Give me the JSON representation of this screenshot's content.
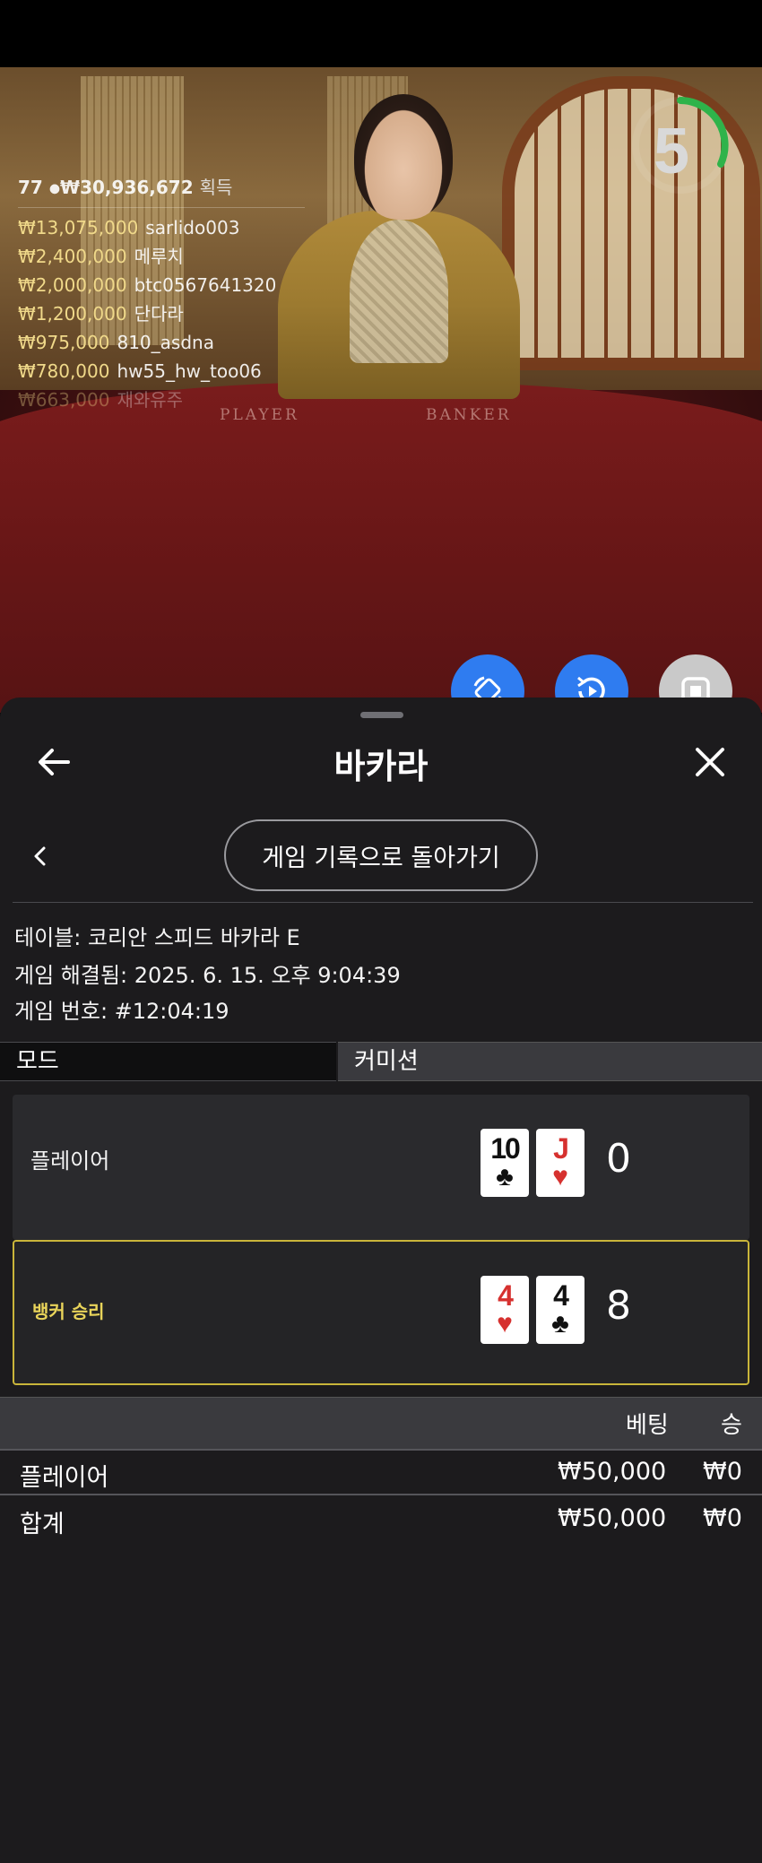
{
  "video": {
    "timer_value": "5",
    "table_labels": {
      "player": "PLAYER",
      "banker": "BANKER"
    },
    "winners": {
      "count": "77",
      "total": "₩30,936,672",
      "title": "획득",
      "rows": [
        {
          "amount": "₩13,075,000",
          "name": "sarlido003"
        },
        {
          "amount": "₩2,400,000",
          "name": "메루치"
        },
        {
          "amount": "₩2,000,000",
          "name": "btc0567641320"
        },
        {
          "amount": "₩1,200,000",
          "name": "단다라"
        },
        {
          "amount": "₩975,000",
          "name": "810_asdna"
        },
        {
          "amount": "₩780,000",
          "name": "hw55_hw_too06"
        },
        {
          "amount": "₩663,000",
          "name": "재와유주"
        }
      ]
    }
  },
  "sheet": {
    "title": "바카라",
    "back_to_history": "게임 기록으로 돌아가기",
    "info": {
      "table": "테이블: 코리안 스피드 바카라 E",
      "resolved": "게임 해결됨: 2025. 6. 15. 오후 9:04:39",
      "game_no": "게임 번호: #12:04:19"
    },
    "mode": {
      "label": "모드",
      "value": "커미션"
    },
    "hands": [
      {
        "label": "플레이어",
        "cards": [
          {
            "rank": "10",
            "suit": "♣",
            "color": "black"
          },
          {
            "rank": "J",
            "suit": "♥",
            "color": "red"
          }
        ],
        "score": "0",
        "winner": false
      },
      {
        "label": "뱅커 승리",
        "cards": [
          {
            "rank": "4",
            "suit": "♥",
            "color": "red"
          },
          {
            "rank": "4",
            "suit": "♣",
            "color": "black"
          }
        ],
        "score": "8",
        "winner": true
      }
    ],
    "bets": {
      "col_bet": "베팅",
      "col_win": "승",
      "rows": [
        {
          "label": "플레이어",
          "bet": "₩50,000",
          "win": "₩0"
        },
        {
          "label": "합계",
          "bet": "₩50,000",
          "win": "₩0"
        }
      ]
    }
  },
  "colors": {
    "fab_blue": "#2f7cf0",
    "fab_gray": "#c9c9c9",
    "winner_border": "#c9b53a",
    "winner_label": "#e9d45a",
    "amount_gold": "#f0d98a",
    "timer_green": "#2fb34a"
  },
  "icons": {
    "fab_1": "rotate-screen-icon",
    "fab_2": "replay-video-icon",
    "fab_3": "stop-icon",
    "nav_back": "arrow-left-icon",
    "nav_close": "close-icon",
    "chevron": "chevron-left-icon"
  }
}
